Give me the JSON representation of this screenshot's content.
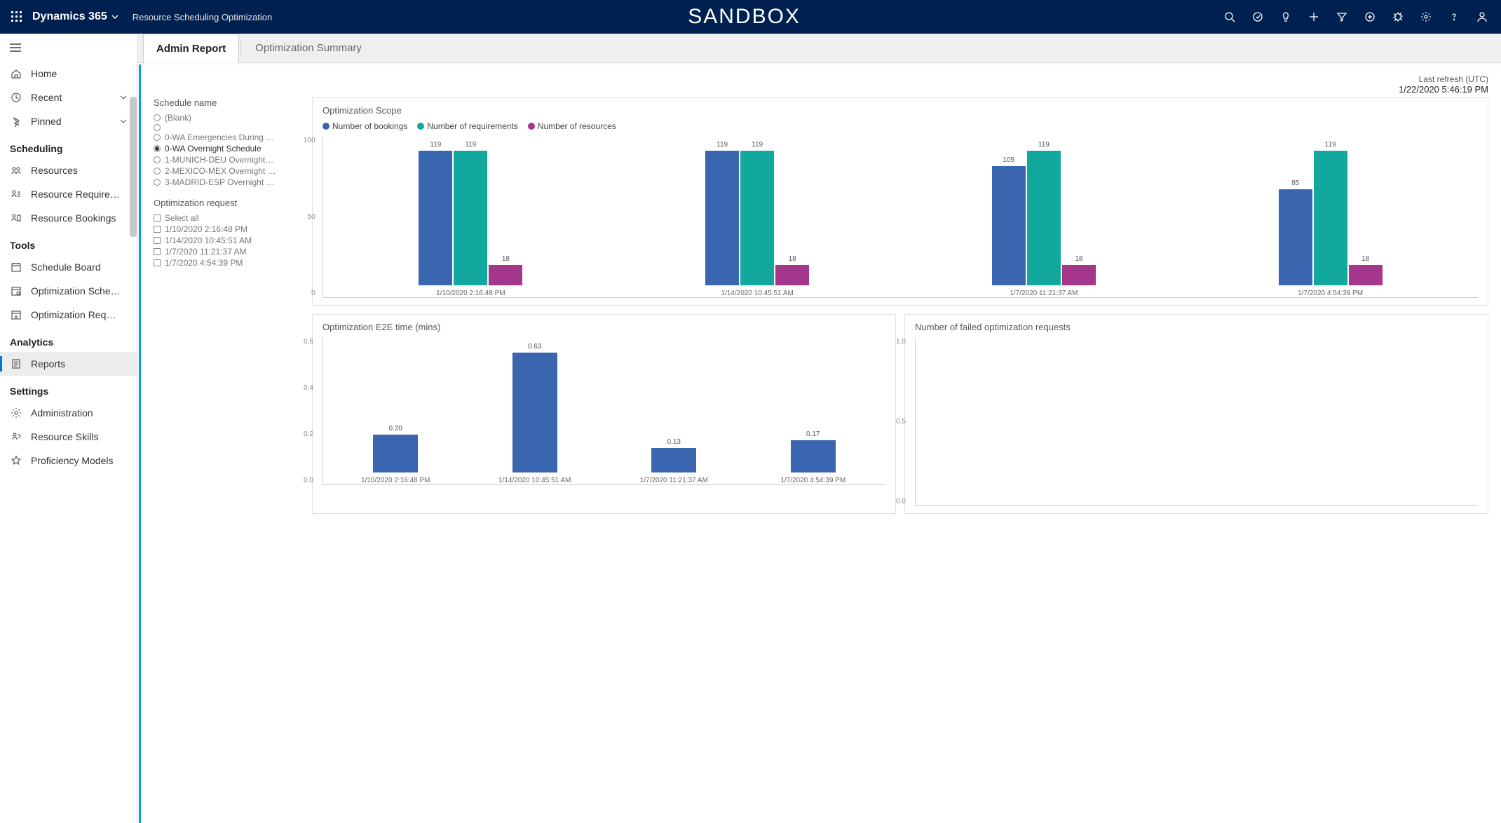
{
  "header": {
    "brand": "Dynamics 365",
    "title": "Resource Scheduling Optimization",
    "center": "SANDBOX"
  },
  "sidebar": {
    "top": [
      {
        "icon": "home",
        "label": "Home",
        "chev": false
      },
      {
        "icon": "clock",
        "label": "Recent",
        "chev": true
      },
      {
        "icon": "pin",
        "label": "Pinned",
        "chev": true
      }
    ],
    "sections": [
      {
        "title": "Scheduling",
        "items": [
          {
            "icon": "people",
            "label": "Resources"
          },
          {
            "icon": "person-list",
            "label": "Resource Require…"
          },
          {
            "icon": "person-book",
            "label": "Resource Bookings"
          }
        ]
      },
      {
        "title": "Tools",
        "items": [
          {
            "icon": "calendar",
            "label": "Schedule Board"
          },
          {
            "icon": "calendar-gear",
            "label": "Optimization Sche…"
          },
          {
            "icon": "calendar-req",
            "label": "Optimization Req…"
          }
        ]
      },
      {
        "title": "Analytics",
        "items": [
          {
            "icon": "report",
            "label": "Reports",
            "selected": true
          }
        ]
      },
      {
        "title": "Settings",
        "items": [
          {
            "icon": "gear",
            "label": "Administration"
          },
          {
            "icon": "skills",
            "label": "Resource Skills"
          },
          {
            "icon": "star",
            "label": "Proficiency Models"
          }
        ]
      }
    ]
  },
  "tabs": [
    {
      "label": "Admin Report",
      "active": true
    },
    {
      "label": "Optimization Summary",
      "active": false
    }
  ],
  "report": {
    "schedule_name_title": "Schedule name",
    "schedule_names": [
      {
        "label": "(Blank)",
        "checked": false
      },
      {
        "label": "",
        "checked": false
      },
      {
        "label": "0-WA Emergencies During …",
        "checked": false
      },
      {
        "label": "0-WA Overnight Schedule",
        "checked": true
      },
      {
        "label": "1-MUNICH-DEU Overnight…",
        "checked": false
      },
      {
        "label": "2-MEXICO-MEX Overnight …",
        "checked": false
      },
      {
        "label": "3-MADRID-ESP Overnight …",
        "checked": false
      }
    ],
    "optimization_request_title": "Optimization request",
    "select_all_label": "Select all",
    "optimization_requests": [
      "1/10/2020 2:16:48 PM",
      "1/14/2020 10:45:51 AM",
      "1/7/2020 11:21:37 AM",
      "1/7/2020 4:54:39 PM"
    ],
    "last_refresh_label": "Last refresh (UTC)",
    "last_refresh_value": "1/22/2020 5:46:19 PM"
  },
  "chart_data": [
    {
      "type": "bar",
      "title": "Optimization Scope",
      "legend": [
        "Number of bookings",
        "Number of requirements",
        "Number of resources"
      ],
      "colors": [
        "#3a66b0",
        "#12a89d",
        "#a4368b"
      ],
      "categories": [
        "1/10/2020 2:16:48 PM",
        "1/14/2020 10:45:51 AM",
        "1/7/2020 11:21:37 AM",
        "1/7/2020 4:54:39 PM"
      ],
      "series": [
        {
          "name": "Number of bookings",
          "values": [
            119,
            119,
            105,
            85
          ]
        },
        {
          "name": "Number of requirements",
          "values": [
            119,
            119,
            119,
            119
          ]
        },
        {
          "name": "Number of resources",
          "values": [
            18,
            18,
            18,
            18
          ]
        }
      ],
      "yticks": [
        0,
        50,
        100
      ],
      "ylim": [
        0,
        130
      ]
    },
    {
      "type": "bar",
      "title": "Optimization E2E time (mins)",
      "color": "#3a66b0",
      "categories": [
        "1/10/2020 2:16:48 PM",
        "1/14/2020 10:45:51 AM",
        "1/7/2020 11:21:37 AM",
        "1/7/2020 4:54:39 PM"
      ],
      "values": [
        0.2,
        0.63,
        0.13,
        0.17
      ],
      "yticks": [
        0.0,
        0.2,
        0.4,
        0.6
      ],
      "ylim": [
        0,
        0.7
      ]
    },
    {
      "type": "bar",
      "title": "Number of failed optimization requests",
      "categories": [],
      "values": [],
      "yticks": [
        0.0,
        0.5,
        1.0
      ],
      "ylim": [
        0,
        1.0
      ]
    }
  ]
}
